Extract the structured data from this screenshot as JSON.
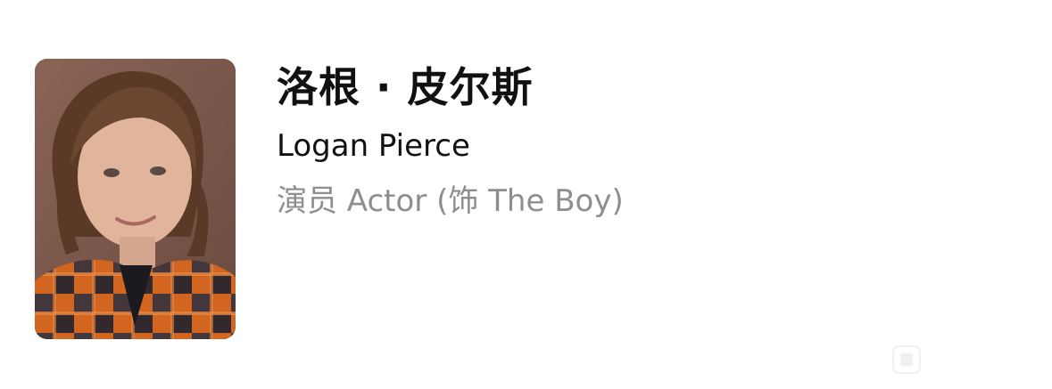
{
  "cast_member": {
    "name_cn": "洛根 · 皮尔斯",
    "name_en": "Logan Pierce",
    "role_text": "演员 Actor (饰 The Boy)"
  },
  "photo": {
    "icon": "portrait-photo"
  },
  "colors": {
    "name": "#111111",
    "role": "#8e8e8e",
    "photo_bg": "#7b574b",
    "shirt_orange": "#d2651f",
    "shirt_dark": "#1f2230"
  }
}
